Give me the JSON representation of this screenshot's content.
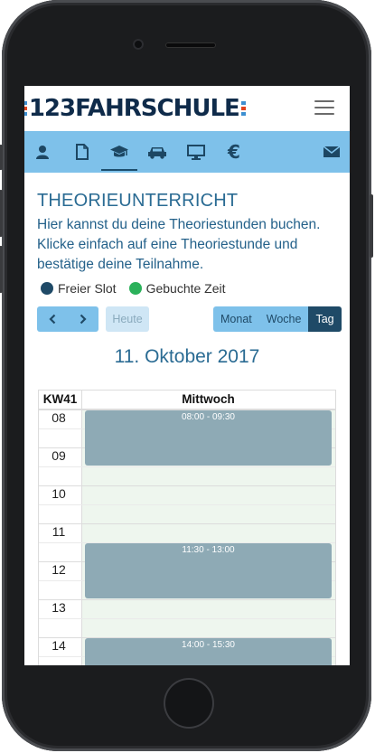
{
  "app": {
    "logo_text": "123FAHRSCHULE",
    "brand_colors": {
      "stripe_red": "#e0431f",
      "stripe_blue": "#3d8fd1",
      "text": "#0f2b4a"
    }
  },
  "nav": {
    "items": [
      {
        "icon": "user-icon"
      },
      {
        "icon": "document-icon"
      },
      {
        "icon": "graduation-cap-icon",
        "active": true
      },
      {
        "icon": "car-icon"
      },
      {
        "icon": "monitor-icon"
      },
      {
        "icon": "euro-icon",
        "glyph": "€"
      },
      {
        "icon": "envelope-icon"
      }
    ],
    "background": "#7ec1ea"
  },
  "page": {
    "title": "THEORIEUNTERRICHT",
    "description": "Hier kannst du deine Theoriestunden buchen. Klicke einfach auf eine Theoriestunde und bestätige deine Teilnahme."
  },
  "legend": [
    {
      "label": "Freier Slot",
      "color": "#1f4a67"
    },
    {
      "label": "Gebuchte Zeit",
      "color": "#2bb15a"
    }
  ],
  "toolbar": {
    "prev": "‹",
    "next": "›",
    "today": "Heute",
    "views": [
      "Monat",
      "Woche",
      "Tag"
    ],
    "active_view": "Tag"
  },
  "calendar": {
    "date_title": "11. Oktober 2017",
    "week_label": "KW41",
    "day_label": "Mittwoch",
    "hours": [
      "08",
      "09",
      "10",
      "11",
      "12",
      "13",
      "14"
    ],
    "events": [
      {
        "time": "08:00 - 09:30",
        "start_hour": 8.0,
        "end_hour": 9.5
      },
      {
        "time": "11:30 - 13:00",
        "start_hour": 11.5,
        "end_hour": 13.0
      },
      {
        "time": "14:00 - 15:30",
        "start_hour": 14.0,
        "end_hour": 15.5
      }
    ]
  }
}
